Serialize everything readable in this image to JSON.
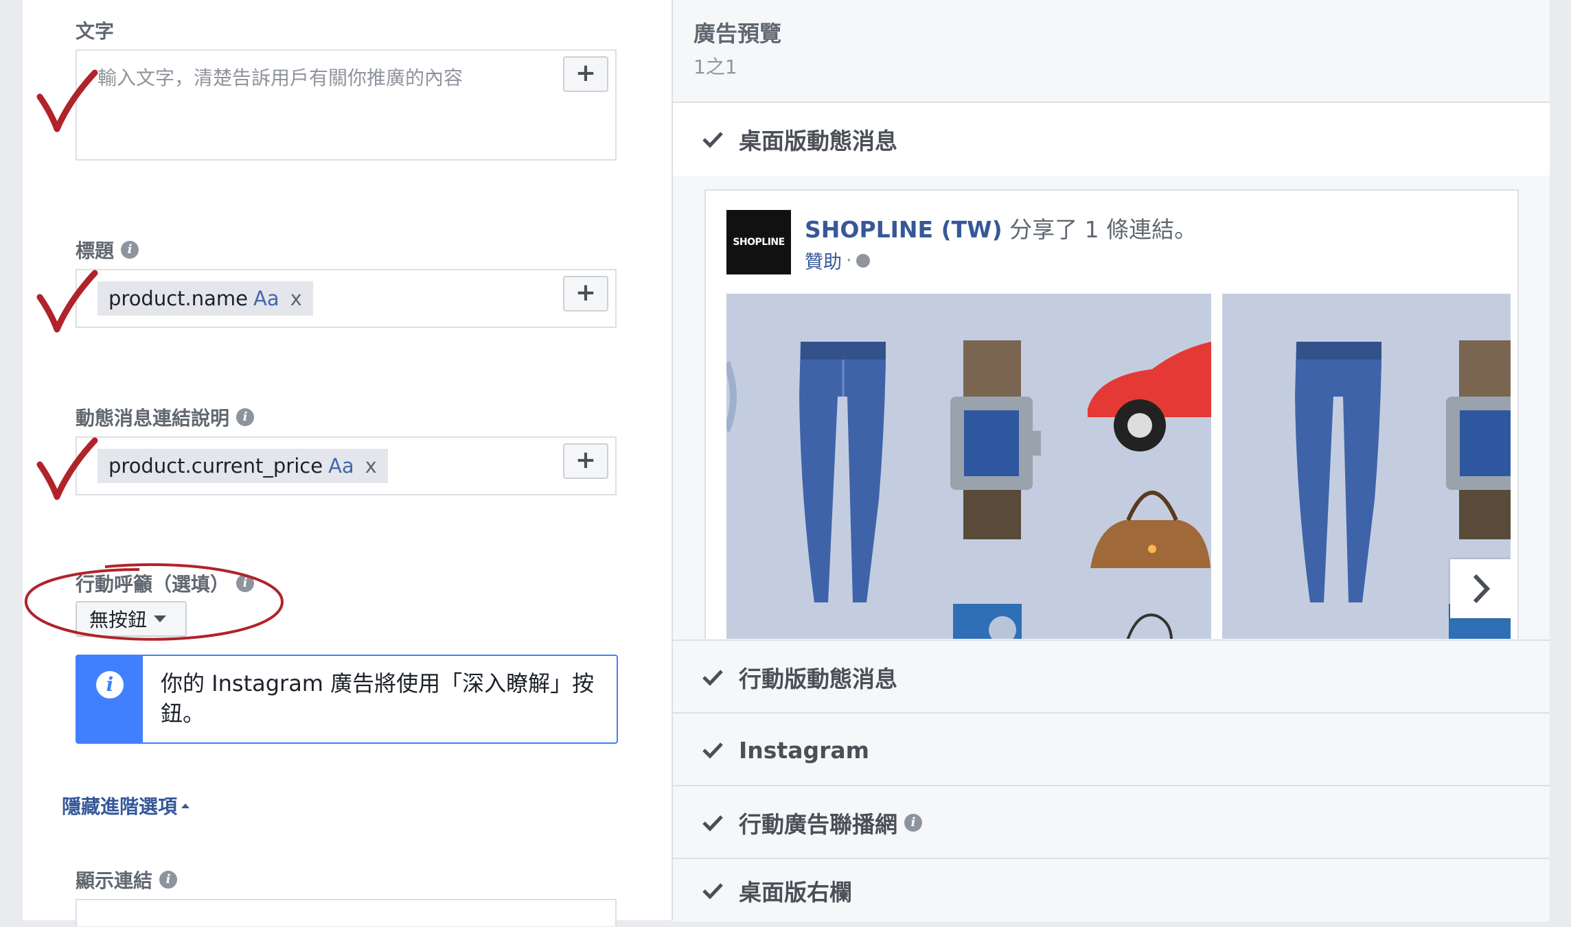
{
  "form": {
    "text_label": "文字",
    "text_placeholder": "輸入文字，清楚告訴用戶有關你推廣的內容",
    "headline_label": "標題",
    "headline_token": "product.name",
    "desc_label": "動態消息連結說明",
    "desc_token": "product.current_price",
    "token_aa": "Aa",
    "token_remove": "x",
    "add_symbol": "+",
    "cta_label": "行動呼籲（選填）",
    "cta_value": "無按鈕",
    "instagram_notice": "你的 Instagram 廣告將使用「深入瞭解」按鈕。",
    "hide_advanced": "隱藏進階選項",
    "display_link_label": "顯示連結",
    "info_glyph": "i"
  },
  "preview": {
    "title": "廣告預覽",
    "count": "1之1",
    "placements": [
      {
        "label": "桌面版動態消息"
      },
      {
        "label": "行動版動態消息"
      },
      {
        "label": "Instagram"
      },
      {
        "label": "行動廣告聯播網"
      },
      {
        "label": "桌面版右欄"
      }
    ],
    "post": {
      "logo_text": "SHOPLINE",
      "page_name": "SHOPLINE (TW)",
      "action": "分享了 1 條連結。",
      "sponsored": "贊助",
      "separator": "·"
    }
  },
  "colors": {
    "check_red": "#b0232a",
    "link_blue": "#365899",
    "notice_blue": "#4080ff",
    "jeans": "#3f63a8",
    "car_red": "#e53935",
    "bag_brown": "#a0693a"
  },
  "icons": [
    "check-icon",
    "info-icon",
    "caret-down-icon",
    "caret-up-icon",
    "chevron-right-icon",
    "globe-icon",
    "plus-icon"
  ]
}
